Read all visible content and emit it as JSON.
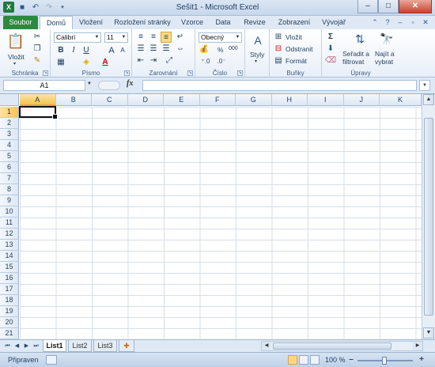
{
  "window": {
    "title": "Sešit1 - Microsoft Excel",
    "buttons": {
      "minimize": "–",
      "maximize": "□",
      "close": "✕"
    }
  },
  "tabs": {
    "file": "Soubor",
    "items": [
      "Domů",
      "Vložení",
      "Rozložení stránky",
      "Vzorce",
      "Data",
      "Revize",
      "Zobrazení",
      "Vývojář"
    ],
    "active": "Domů"
  },
  "ribbon": {
    "clipboard": {
      "paste": "Vložit",
      "label": "Schránka"
    },
    "font": {
      "name": "Calibri",
      "size": "11",
      "bold": "B",
      "italic": "I",
      "underline": "U",
      "grow": "A",
      "shrink": "A",
      "color": "A",
      "label": "Písmo"
    },
    "alignment": {
      "label": "Zarovnání"
    },
    "number": {
      "format": "Obecný",
      "currency": "%",
      "comma": "000",
      "label": "Číslo"
    },
    "styles": {
      "button": "Styly"
    },
    "cells": {
      "insert": "Vložit",
      "delete": "Odstranit",
      "format": "Formát",
      "label": "Buňky"
    },
    "editing": {
      "sum": "Σ",
      "sort": "Seřadit a filtrovat",
      "sort_l1": "Seřadit a",
      "sort_l2": "filtrovat",
      "find_l1": "Najít a",
      "find_l2": "vybrat",
      "label": "Úpravy"
    }
  },
  "formula_bar": {
    "name_box": "A1",
    "fx": "fx",
    "value": ""
  },
  "grid": {
    "columns": [
      "A",
      "B",
      "C",
      "D",
      "E",
      "F",
      "G",
      "H",
      "I",
      "J",
      "K"
    ],
    "rows": [
      "1",
      "2",
      "3",
      "4",
      "5",
      "6",
      "7",
      "8",
      "9",
      "10",
      "11",
      "12",
      "13",
      "14",
      "15",
      "16",
      "17",
      "18",
      "19",
      "20",
      "21"
    ],
    "active_cell": "A1"
  },
  "sheets": {
    "tabs": [
      "List1",
      "List2",
      "List3"
    ],
    "active": "List1"
  },
  "status": {
    "text": "Připraven",
    "zoom": "100 %"
  }
}
